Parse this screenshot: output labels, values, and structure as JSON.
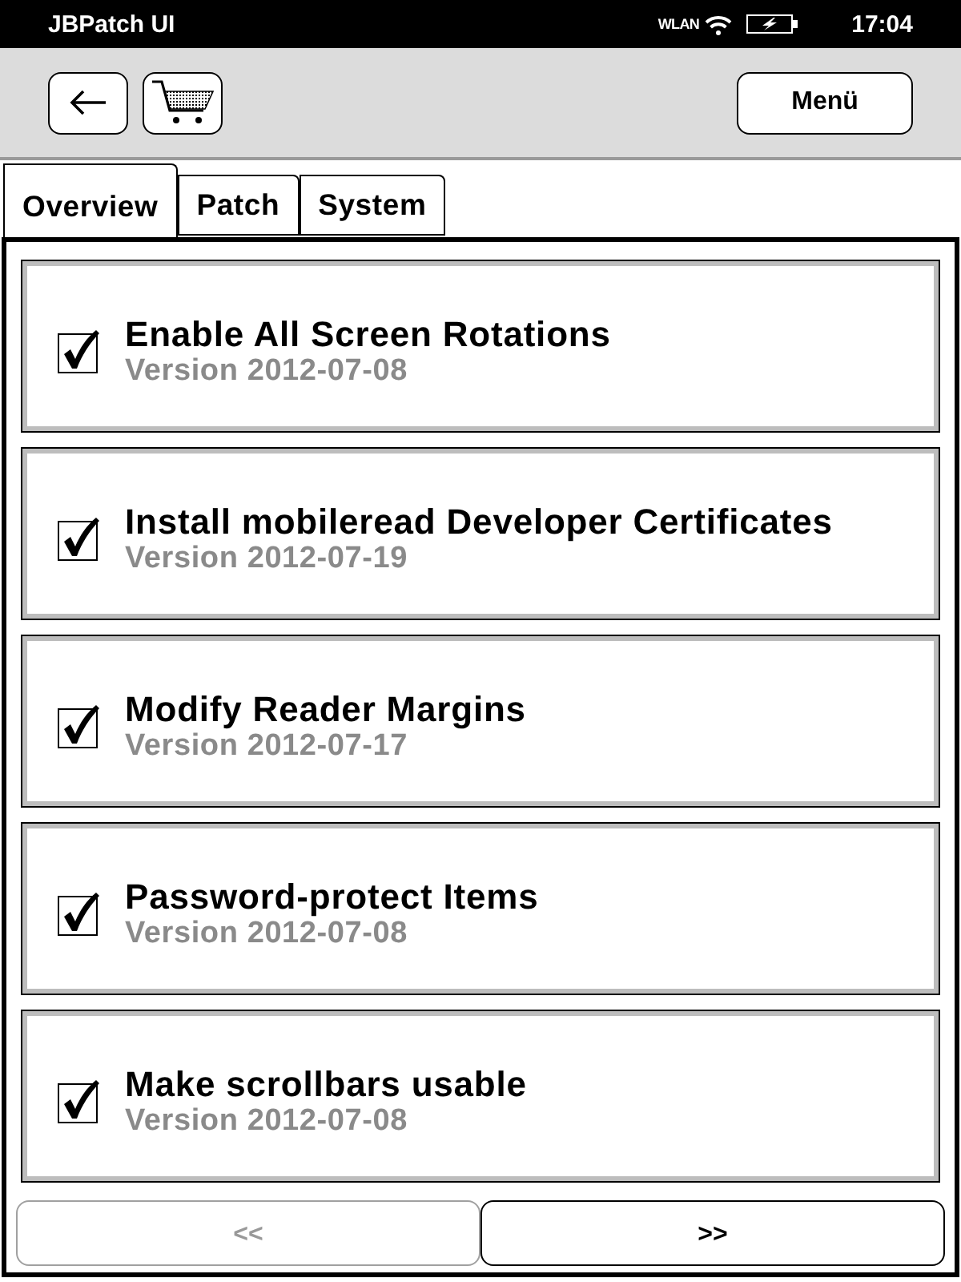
{
  "status_bar": {
    "title": "JBPatch UI",
    "wlan": "WLAN",
    "time": "17:04"
  },
  "toolbar": {
    "menu_button": "Menü"
  },
  "tabs": [
    {
      "label": "Overview",
      "selected": true
    },
    {
      "label": "Patch",
      "selected": false
    },
    {
      "label": "System",
      "selected": false
    }
  ],
  "patches": [
    {
      "title": "Enable All Screen Rotations",
      "version": "Version 2012-07-08",
      "checked": true
    },
    {
      "title": "Install mobileread Developer Certificates",
      "version": "Version 2012-07-19",
      "checked": true
    },
    {
      "title": "Modify Reader Margins",
      "version": "Version 2012-07-17",
      "checked": true
    },
    {
      "title": "Password-protect Items",
      "version": "Version 2012-07-08",
      "checked": true
    },
    {
      "title": "Make scrollbars usable",
      "version": "Version 2012-07-08",
      "checked": true
    }
  ],
  "pagination": [
    {
      "label": "<<",
      "disabled": true
    },
    {
      "label": ">>",
      "disabled": false
    }
  ]
}
